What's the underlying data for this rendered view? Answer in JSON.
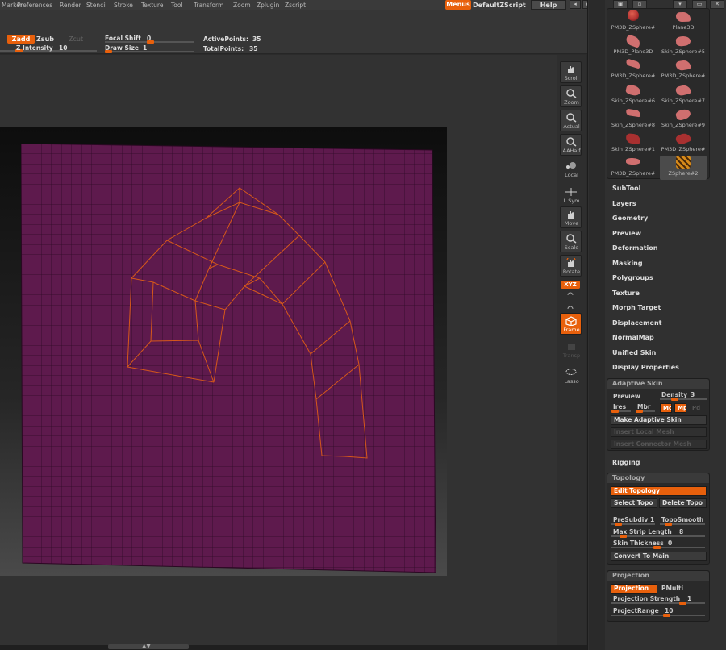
{
  "menubar": {
    "items": [
      "Marker",
      "Preferences",
      "Render",
      "Stencil",
      "Stroke",
      "Texture",
      "Tool",
      "Transform",
      "Zoom",
      "Zplugin",
      "Zscript"
    ],
    "menus_label": "Menus",
    "default_zscript": "DefaultZScript",
    "help_label": "Help"
  },
  "toolbar": {
    "zadd": "Zadd",
    "zsub": "Zsub",
    "zcut": "Zcut",
    "z_intensity_label": "Z Intensity",
    "z_intensity_value": "10",
    "focal_shift_label": "Focal Shift",
    "focal_shift_value": "0",
    "draw_size_label": "Draw Size",
    "draw_size_value": "1",
    "active_points_label": "ActivePoints:",
    "active_points_value": "35",
    "total_points_label": "TotalPoints:",
    "total_points_value": "35"
  },
  "shelf": {
    "buttons": [
      "Scroll",
      "Zoom",
      "Actual",
      "AAHalf",
      "Local",
      "L.Sym",
      "Move",
      "Scale",
      "Rotate",
      "XYZ",
      "Frame",
      "Transp",
      "Lasso"
    ]
  },
  "subtools": [
    {
      "name": "PM3D_ZSphere#",
      "color": "#b03030"
    },
    {
      "name": "Plane3D",
      "color": "#d06f6f"
    },
    {
      "name": "PM3D_Plane3D",
      "color": "#d06f6f"
    },
    {
      "name": "Skin_ZSphere#5",
      "color": "#d06f6f"
    },
    {
      "name": "PM3D_ZSphere#",
      "color": "#d06f6f"
    },
    {
      "name": "PM3D_ZSphere#",
      "color": "#d06f6f"
    },
    {
      "name": "Skin_ZSphere#6",
      "color": "#d06f6f"
    },
    {
      "name": "Skin_ZSphere#7",
      "color": "#d06f6f"
    },
    {
      "name": "Skin_ZSphere#8",
      "color": "#d06f6f"
    },
    {
      "name": "Skin_ZSphere#9",
      "color": "#d06f6f"
    },
    {
      "name": "Skin_ZSphere#1",
      "color": "#a83030"
    },
    {
      "name": "PM3D_ZSphere#",
      "color": "#a83030"
    },
    {
      "name": "PM3D_ZSphere#",
      "color": "#d06f6f"
    },
    {
      "name": "ZSphere#2",
      "color": "#d68a1a"
    }
  ],
  "tool_menus": [
    "SubTool",
    "Layers",
    "Geometry",
    "Preview",
    "Deformation",
    "Masking",
    "Polygroups",
    "Texture",
    "Morph Target",
    "Displacement",
    "NormalMap",
    "Unified Skin",
    "Display Properties"
  ],
  "adaptive_skin": {
    "title": "Adaptive Skin",
    "preview": "Preview",
    "density_label": "Density",
    "density_value": "3",
    "ires": "Ires",
    "mbr": "Mbr",
    "mc": "Mc",
    "mp": "Mp",
    "pd": "Pd",
    "make": "Make Adaptive Skin",
    "insert_local": "Insert Local Mesh",
    "insert_connector": "Insert Connector Mesh"
  },
  "rigging": "Rigging",
  "topology": {
    "title": "Topology",
    "edit": "Edit Topology",
    "select": "Select Topo",
    "delete": "Delete Topo",
    "presubdiv_label": "PreSubdiv",
    "presubdiv_value": "1",
    "toposmooth": "TopoSmooth",
    "max_strip_label": "Max Strip Length",
    "max_strip_value": "8",
    "skin_thickness_label": "Skin Thickness",
    "skin_thickness_value": "0",
    "convert": "Convert To Main"
  },
  "projection": {
    "title": "Projection",
    "projection_btn": "Projection",
    "pmulti": "PMulti",
    "strength_label": "Projection Strength",
    "strength_value": "1",
    "range_label": "ProjectRange",
    "range_value": "10"
  },
  "colors": {
    "accent": "#e8600c",
    "plane": "#5e1a4d",
    "grid_line": "#2e0a26",
    "topology_line": "#d6581a"
  }
}
